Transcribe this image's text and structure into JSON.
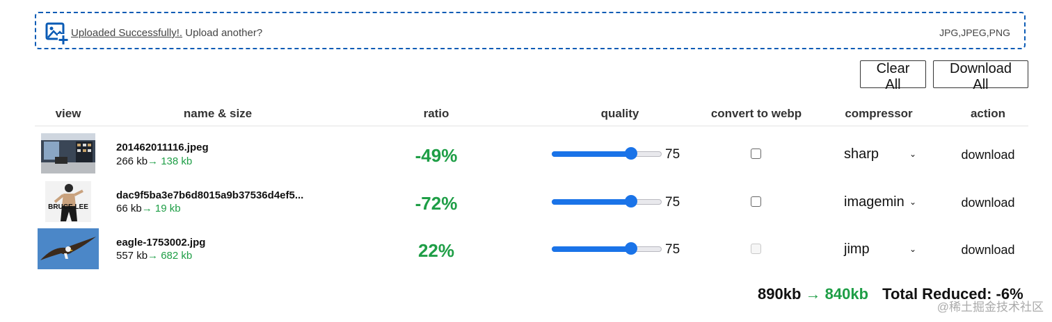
{
  "upload": {
    "link_text": "Uploaded Successfully!.",
    "prompt_text": "Upload another?",
    "formats": "JPG,JPEG,PNG",
    "icon": "image-add-icon"
  },
  "toolbar": {
    "clear_label": "Clear All",
    "download_label": "Download All"
  },
  "table": {
    "headers": [
      "view",
      "name & size",
      "ratio",
      "quality",
      "convert to webp",
      "compressor",
      "action"
    ],
    "rows": [
      {
        "name": "201462011116.jpeg",
        "size": "266 kb",
        "new_size": "→ 138 kb",
        "ratio": "-49%",
        "quality": 75,
        "quality_label": "75",
        "webp_checked": false,
        "webp_disabled": false,
        "compressor": "sharp",
        "action": "download",
        "thumb": "room-photo"
      },
      {
        "name": "dac9f5ba3e7b6d8015a9b37536d4ef5...",
        "size": "66 kb",
        "new_size": "→ 19 kb",
        "ratio": "-72%",
        "quality": 75,
        "quality_label": "75",
        "webp_checked": false,
        "webp_disabled": false,
        "compressor": "imagemin",
        "action": "download",
        "thumb": "bruce-lee-photo",
        "thumb_text": "BRUCE LEE"
      },
      {
        "name": "eagle-1753002.jpg",
        "size": "557 kb",
        "new_size": "→ 682 kb",
        "ratio": "22%",
        "quality": 75,
        "quality_label": "75",
        "webp_checked": false,
        "webp_disabled": true,
        "compressor": "jimp",
        "action": "download",
        "thumb": "eagle-photo"
      }
    ]
  },
  "totals": {
    "before": "890kb",
    "arrow": "→",
    "after": "840kb",
    "reduced": "Total Reduced: -6%"
  },
  "watermark": "@稀土掘金技术社区",
  "colors": {
    "accent": "#1a73e8",
    "success": "#1e9e46",
    "border": "#0b5bb5"
  }
}
